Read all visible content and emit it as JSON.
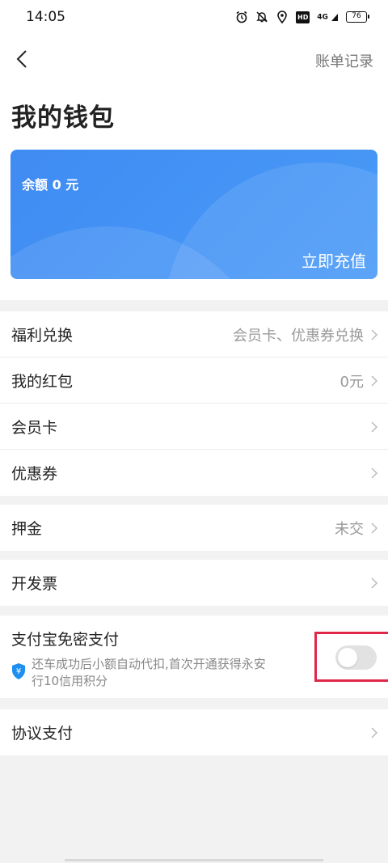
{
  "status_bar": {
    "time": "14:05",
    "network": "4G",
    "battery": "76",
    "hd": "HD",
    "icons": [
      "alarm-icon",
      "mute-icon",
      "location-icon",
      "hd-icon",
      "signal-icon",
      "battery-icon"
    ]
  },
  "header": {
    "back_icon": "back-icon",
    "bill_link": "账单记录",
    "title": "我的钱包"
  },
  "wallet_card": {
    "balance": "余额 0 元",
    "recharge": "立即充值",
    "color": "#4493f5"
  },
  "menu": {
    "welfare": {
      "label": "福利兑换",
      "value": "会员卡、优惠券兑换"
    },
    "red_packet": {
      "label": "我的红包",
      "value": "0元"
    },
    "member_card": {
      "label": "会员卡"
    },
    "coupon": {
      "label": "优惠券"
    },
    "deposit": {
      "label": "押金",
      "value": "未交"
    },
    "invoice": {
      "label": "开发票"
    },
    "alipay": {
      "label": "支付宝免密支付",
      "description": "还车成功后小额自动代扣,首次开通获得永安行10信用积分",
      "toggle_on": false,
      "highlight_color": "#e2264a"
    },
    "agreement": {
      "label": "协议支付"
    }
  }
}
